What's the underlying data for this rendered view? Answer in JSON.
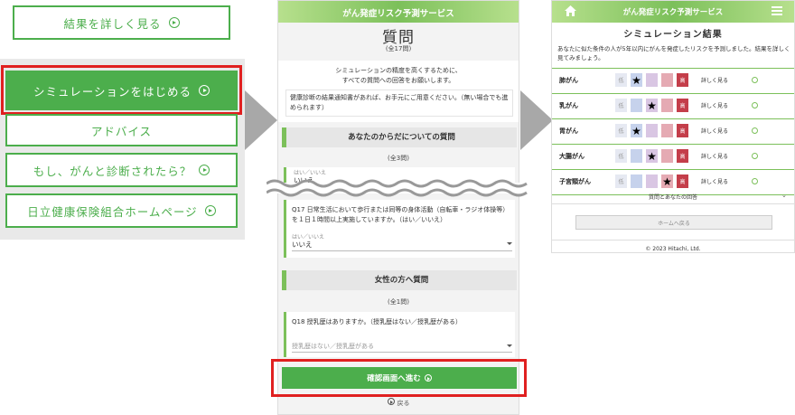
{
  "left_menu": {
    "detail_button": "結果を詳しく見る",
    "simulation_button": "シミュレーションをはじめる",
    "advice_button": "アドバイス",
    "diagnosed_button": "もし、がんと診断されたら？",
    "homepage_button": "日立健康保険組合ホームページ"
  },
  "questionnaire": {
    "banner": "がん発症リスク予測サービス",
    "title": "質問",
    "total_count": "(全17問)",
    "intro_line1": "シミュレーションの精度を高くするために、",
    "intro_line2": "すべての質問への回答をお願いします。",
    "notice": "健康診断の結果通知書があれば、お手元にご用意ください。（無い場合でも進められます）",
    "section1": {
      "title": "あなたのからだについての質問",
      "count": "(全3問)"
    },
    "partial_field": {
      "label": "はい／いいえ",
      "value": "いいえ"
    },
    "q17": {
      "text": "Q17 日常生活において歩行または同等の身体活動（自転車・ラジオ体操等）を１日１時間以上実施していますか。（はい／いいえ）",
      "label": "はい／いいえ",
      "value": "いいえ"
    },
    "section2": {
      "title": "女性の方へ質問",
      "count": "(全1問)"
    },
    "q18": {
      "text": "Q18 授乳歴はありますか。（授乳歴はない／授乳歴がある）",
      "placeholder": "授乳歴はない／授乳歴がある"
    },
    "confirm_button": "確認画面へ進む",
    "back_link": "戻る"
  },
  "results": {
    "banner": "がん発症リスク予測サービス",
    "title": "シミュレーション結果",
    "description": "あなたに似た条件の人が5年以内にがんを発症したリスクを予測しました。結果を詳しく見てみましょう。",
    "low_label": "低",
    "high_label": "高",
    "detail_label": "詳しく見る",
    "rows": [
      {
        "name": "肺がん",
        "level": 1
      },
      {
        "name": "乳がん",
        "level": 2
      },
      {
        "name": "胃がん",
        "level": 1
      },
      {
        "name": "大腸がん",
        "level": 2
      },
      {
        "name": "子宮頸がん",
        "level": 3
      }
    ],
    "qa_link": "質問とあなたの回答",
    "home_button": "ホームへ戻る",
    "copyright": "© 2023 Hitachi, Ltd."
  },
  "colors": {
    "accent": "#4cae4c",
    "highlight": "#e02020",
    "arrow": "#a8a8a8"
  }
}
